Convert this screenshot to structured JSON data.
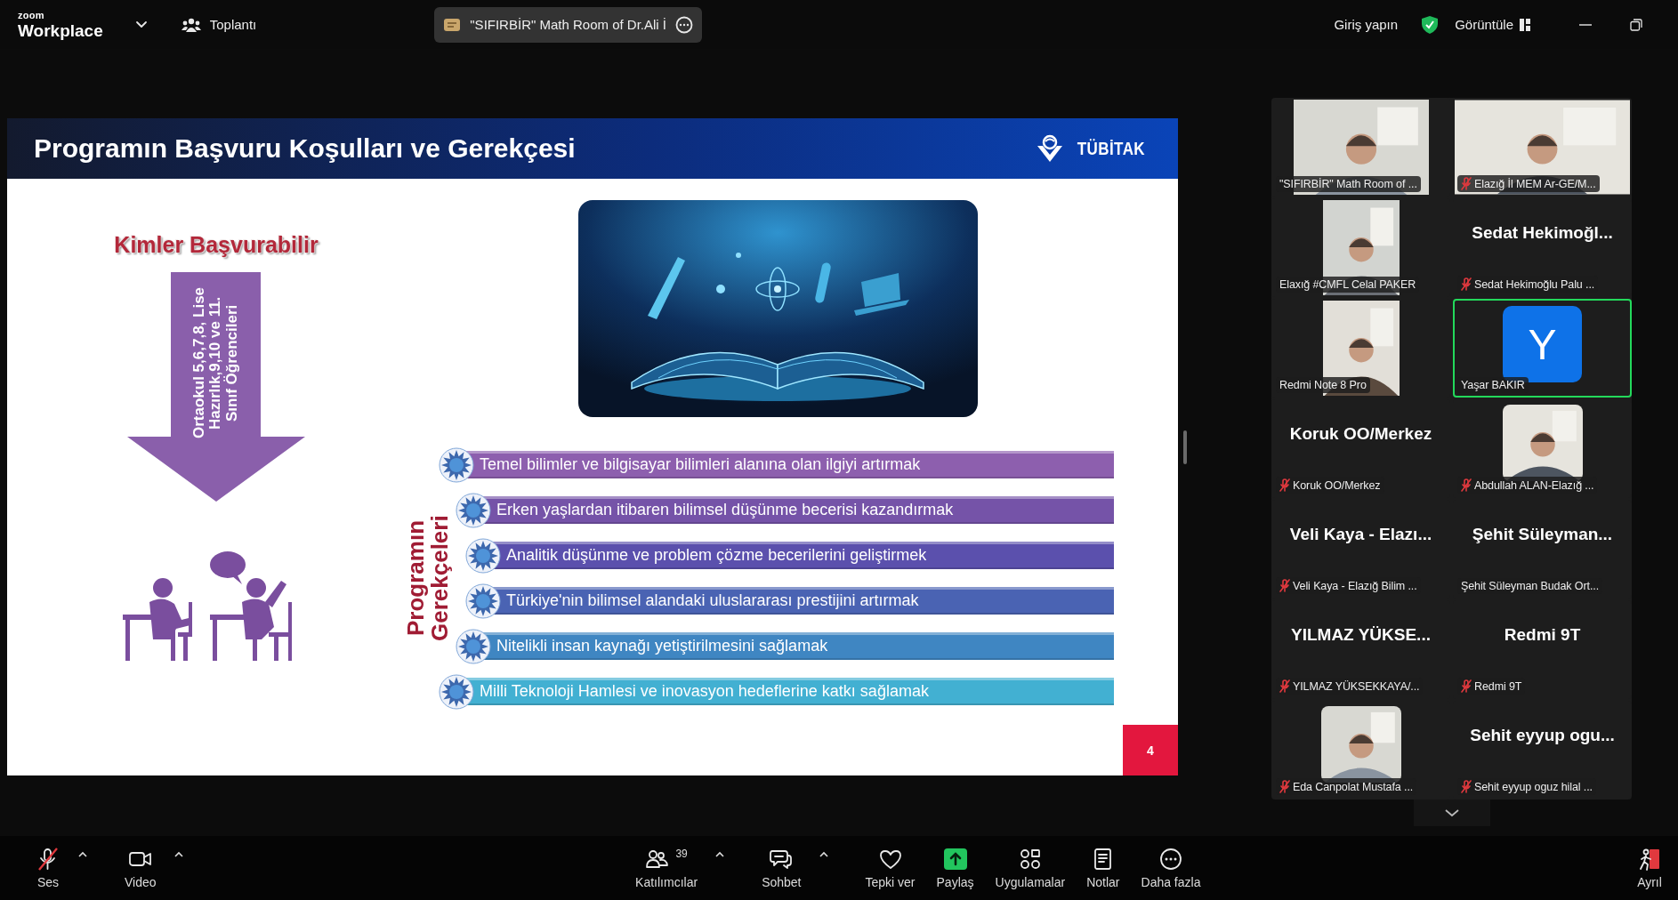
{
  "title_bar": {
    "brand_small": "zoom",
    "brand": "Workplace",
    "meeting_menu": "Toplantı",
    "meeting_tab": "\"SIFIRBİR\" Math Room of Dr.Ali İ",
    "sign_in": "Giriş yapın",
    "view_menu": "Görüntüle"
  },
  "slide": {
    "title": "Programın Başvuru Koşulları ve Gerekçesi",
    "brand": "TÜBİTAK",
    "audience_heading": "Kimler Başvurabilir",
    "audience": "Ortaokul 5,6,7,8, Lise Hazırlık,9,10 ve 11. Sınıf Öğrencileri",
    "reasons_heading": "Programın Gerekçeleri",
    "reasons": [
      {
        "text": "Temel bilimler ve bilgisayar bilimleri alanına olan ilgiyi artırmak",
        "color": "#8d5fae"
      },
      {
        "text": "Erken yaşlardan itibaren bilimsel düşünme becerisi kazandırmak",
        "color": "#7553a8"
      },
      {
        "text": "Analitik düşünme ve problem çözme becerilerini geliştirmek",
        "color": "#5b50ad"
      },
      {
        "text": "Türkiye'nin bilimsel alandaki uluslararası prestijini artırmak",
        "color": "#4a63b3"
      },
      {
        "text": "Nitelikli insan kaynağı yetiştirilmesini sağlamak",
        "color": "#3f86c2"
      },
      {
        "text": "Milli Teknoloji Hamlesi ve inovasyon hedeflerine katkı sağlamak",
        "color": "#42b0d2"
      }
    ],
    "page_number": "4"
  },
  "gallery": {
    "tiles": [
      {
        "kind": "widecam",
        "label": "\"SIFIRBİR\" Math Room of ...",
        "muted": false,
        "speaking": false
      },
      {
        "kind": "fullcam",
        "label": "Elazığ İl MEM Ar-GE/M...",
        "muted": true,
        "speaking": false
      },
      {
        "kind": "portraitcam",
        "label": "Elaxığ #CMFL Celal PAKER",
        "muted": false,
        "speaking": false
      },
      {
        "kind": "name",
        "display_name": "Sedat Hekimoğl...",
        "label": "Sedat Hekimoğlu Palu ...",
        "muted": true,
        "speaking": false
      },
      {
        "kind": "portraitcam",
        "label": "Redmi Note 8 Pro",
        "muted": false,
        "speaking": false
      },
      {
        "kind": "avatar",
        "initial": "Y",
        "label": "Yaşar BAKIR",
        "muted": false,
        "speaking": true
      },
      {
        "kind": "name",
        "display_name": "Koruk OO/Merkez",
        "label": "Koruk OO/Merkez",
        "muted": true,
        "speaking": false
      },
      {
        "kind": "squarecam",
        "label": "Abdullah ALAN-Elazığ ...",
        "muted": true,
        "speaking": false
      },
      {
        "kind": "name",
        "display_name": "Veli Kaya - Elazı...",
        "label": "Veli Kaya - Elazığ Bilim ...",
        "muted": true,
        "speaking": false
      },
      {
        "kind": "name",
        "display_name": "Şehit Süleyman...",
        "label": "Şehit Süleyman Budak Ort...",
        "muted": false,
        "speaking": false
      },
      {
        "kind": "name",
        "display_name": "YILMAZ YÜKSE...",
        "label": "YILMAZ YÜKSEKKAYA/...",
        "muted": true,
        "speaking": false
      },
      {
        "kind": "name",
        "display_name": "Redmi 9T",
        "label": "Redmi 9T",
        "muted": true,
        "speaking": false
      },
      {
        "kind": "squarecam",
        "label": "Eda Canpolat  Mustafa ...",
        "muted": true,
        "speaking": false
      },
      {
        "kind": "name",
        "display_name": "Sehit eyyup ogu...",
        "label": "Sehit eyyup oguz hilal ...",
        "muted": true,
        "speaking": false
      }
    ]
  },
  "toolbar": {
    "items": [
      {
        "kind": "audio",
        "label": "Ses",
        "muted": true,
        "menu": true
      },
      {
        "kind": "video",
        "label": "Video",
        "muted": false,
        "menu": true
      },
      {
        "kind": "participants",
        "label": "Katılımcılar",
        "count": "39",
        "menu": true
      },
      {
        "kind": "chat",
        "label": "Sohbet",
        "menu": true
      },
      {
        "kind": "reactions",
        "label": "Tepki ver",
        "menu": false
      },
      {
        "kind": "share",
        "label": "Paylaş",
        "menu": false
      },
      {
        "kind": "apps",
        "label": "Uygulamalar",
        "menu": false
      },
      {
        "kind": "notes",
        "label": "Notlar",
        "menu": false
      },
      {
        "kind": "more",
        "label": "Daha fazla",
        "menu": false
      },
      {
        "kind": "leave",
        "label": "Ayrıl",
        "menu": false
      }
    ]
  }
}
